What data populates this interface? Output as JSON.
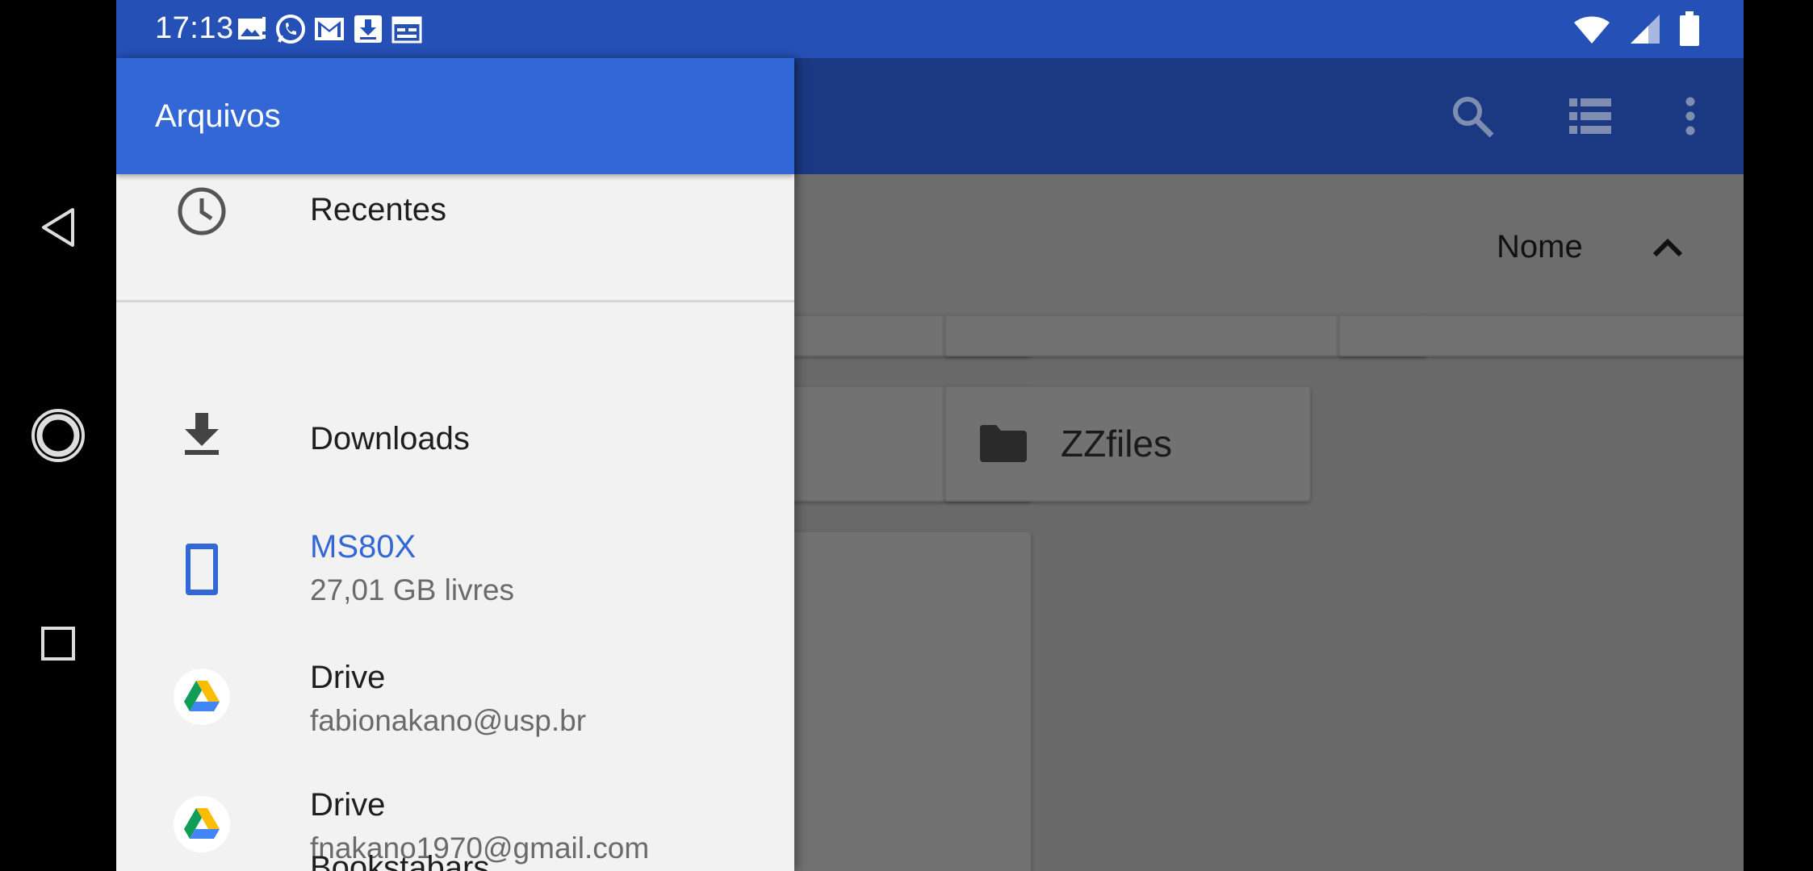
{
  "status_bar": {
    "time": "17:13",
    "left_icons": [
      "gallery-icon",
      "whatsapp-icon",
      "gmail-icon",
      "download-notification-icon",
      "calendar-icon"
    ],
    "right_icons": [
      "wifi-icon",
      "signal-icon",
      "battery-icon"
    ]
  },
  "app_toolbar": {
    "icons": [
      "search-icon",
      "list-view-icon",
      "more-vert-icon"
    ]
  },
  "content": {
    "sort_label": "Nome",
    "folders": [
      {
        "name": "ZZfiles"
      }
    ]
  },
  "drawer": {
    "title": "Arquivos",
    "items": [
      {
        "label": "Recentes",
        "icon": "clock-icon"
      },
      {
        "label": "Downloads",
        "icon": "download-icon"
      },
      {
        "label": "MS80X",
        "sublabel": "27,01 GB livres",
        "icon": "phone-icon",
        "active": true
      },
      {
        "label": "Drive",
        "sublabel": "fabionakano@usp.br",
        "icon": "google-drive-icon"
      },
      {
        "label": "Drive",
        "sublabel": "fnakano1970@gmail.com",
        "icon": "google-drive-icon"
      },
      {
        "label": "Bookstabars",
        "icon": "bookshelf-icon"
      }
    ]
  },
  "colors": {
    "status_bar": "#2550b6",
    "drawer_header": "#3367d6",
    "active_item": "#3367d6",
    "dimmed_toolbar": "#1b3983"
  }
}
